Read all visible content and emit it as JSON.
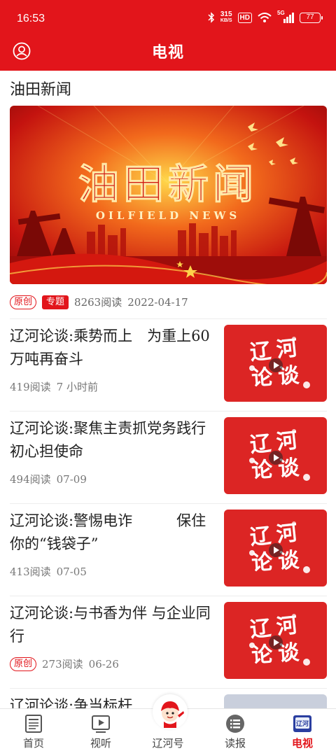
{
  "status_bar": {
    "time": "16:53",
    "net_speed_value": "315",
    "net_speed_unit": "KB/S",
    "hd": "HD",
    "signal": "5G",
    "battery": "77"
  },
  "header": {
    "title": "电视"
  },
  "featured": {
    "section_title": "油田新闻",
    "banner_title": "油田新闻",
    "banner_subtitle": "OILFIELD NEWS",
    "tag_original": "原创",
    "tag_topic": "专题",
    "reads": "8263阅读",
    "date": "2022-04-17"
  },
  "news": [
    {
      "title": "辽河论谈:乘势而上　为重上60万吨再奋斗",
      "reads": "419阅读",
      "time": "7 小时前",
      "tag": ""
    },
    {
      "title": "辽河论谈:聚焦主责抓党务践行初心担使命",
      "reads": "494阅读",
      "time": "07-09",
      "tag": ""
    },
    {
      "title": "辽河论谈:警惕电诈　　　保住你的“钱袋子”",
      "reads": "413阅读",
      "time": "07-05",
      "tag": ""
    },
    {
      "title": "辽河论谈:与书香为伴 与企业同行",
      "reads": "273阅读",
      "time": "06-26",
      "tag": "原创"
    },
    {
      "title": "辽河论谈:争当标杆",
      "reads": "",
      "time": "",
      "tag": ""
    }
  ],
  "thumb_text": {
    "line1": "辽河",
    "line2": "论谈"
  },
  "nav": {
    "items": [
      {
        "label": "首页",
        "icon": "newspaper-icon"
      },
      {
        "label": "视听",
        "icon": "play-icon"
      },
      {
        "label": "辽河号",
        "icon": "mascot-icon"
      },
      {
        "label": "读报",
        "icon": "list-icon"
      },
      {
        "label": "电视",
        "icon": "tv-icon"
      }
    ],
    "active_index": 4
  },
  "colors": {
    "brand_red": "#e2151b",
    "text": "#222222",
    "muted": "#777777"
  }
}
